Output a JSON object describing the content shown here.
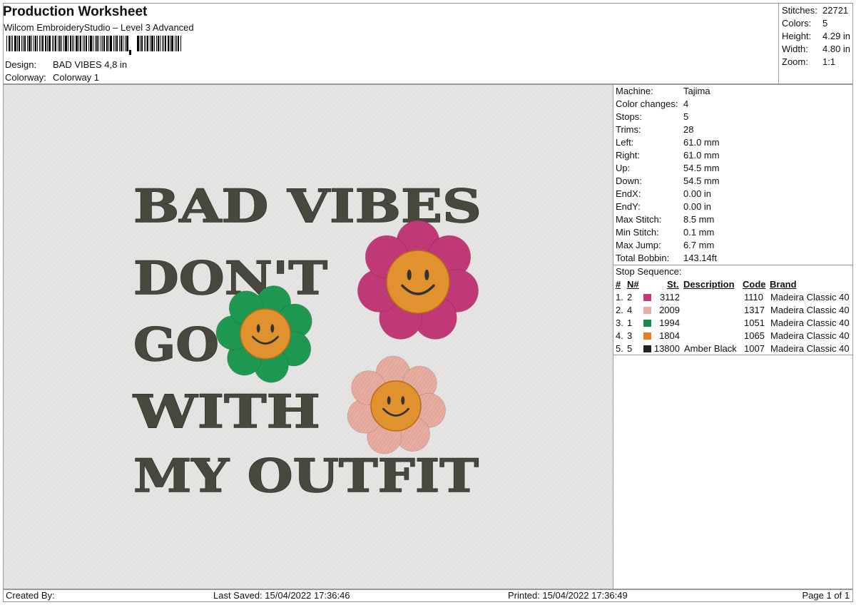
{
  "header": {
    "title": "Production Worksheet",
    "subtitle": "Wilcom EmbroideryStudio – Level 3 Advanced",
    "design_label": "Design:",
    "design_value": "BAD VIBES 4,8 in",
    "colorway_label": "Colorway:",
    "colorway_value": "Colorway 1"
  },
  "summary": [
    {
      "label": "Stitches:",
      "value": "22721"
    },
    {
      "label": "Colors:",
      "value": "5"
    },
    {
      "label": "Height:",
      "value": "4.29 in"
    },
    {
      "label": "Width:",
      "value": "4.80 in"
    },
    {
      "label": "Zoom:",
      "value": "1:1"
    }
  ],
  "machine": [
    {
      "label": "Machine:",
      "value": "Tajima"
    },
    {
      "label": "Color changes:",
      "value": "4"
    },
    {
      "label": "Stops:",
      "value": "5"
    },
    {
      "label": "Trims:",
      "value": "28"
    },
    {
      "label": "Left:",
      "value": "61.0 mm"
    },
    {
      "label": "Right:",
      "value": "61.0 mm"
    },
    {
      "label": "Up:",
      "value": "54.5 mm"
    },
    {
      "label": "Down:",
      "value": "54.5 mm"
    },
    {
      "label": "EndX:",
      "value": "0.00 in"
    },
    {
      "label": "EndY:",
      "value": "0.00 in"
    },
    {
      "label": "Max Stitch:",
      "value": "8.5 mm"
    },
    {
      "label": "Min Stitch:",
      "value": "0.1 mm"
    },
    {
      "label": "Max Jump:",
      "value": "6.7 mm"
    },
    {
      "label": "Total Bobbin:",
      "value": "143.14ft"
    }
  ],
  "stop_sequence": {
    "title": "Stop Sequence:",
    "headers": {
      "num": "#",
      "n": "N#",
      "st": "St.",
      "desc": "Description",
      "code": "Code",
      "brand": "Brand"
    },
    "rows": [
      {
        "num": "1.",
        "n": "2",
        "color": "#c23a78",
        "st": "3112",
        "desc": "",
        "code": "1110",
        "brand": "Madeira Classic 40"
      },
      {
        "num": "2.",
        "n": "4",
        "color": "#e8aca0",
        "st": "2009",
        "desc": "",
        "code": "1317",
        "brand": "Madeira Classic 40"
      },
      {
        "num": "3.",
        "n": "1",
        "color": "#1a8a4a",
        "st": "1994",
        "desc": "",
        "code": "1051",
        "brand": "Madeira Classic 40"
      },
      {
        "num": "4.",
        "n": "3",
        "color": "#e57e1e",
        "st": "1804",
        "desc": "",
        "code": "1065",
        "brand": "Madeira Classic 40"
      },
      {
        "num": "5.",
        "n": "5",
        "color": "#222222",
        "st": "13800",
        "desc": "Amber Black",
        "code": "1007",
        "brand": "Madeira Classic 40"
      }
    ]
  },
  "design": {
    "lines": [
      "BAD VIBES",
      "DON'T",
      "GO",
      "WITH",
      "MY OUTFIT"
    ],
    "colors": {
      "text": "#48483f",
      "pink": "#c23a78",
      "green": "#1f9a52",
      "peach": "#e8aca0",
      "orange": "#e0922e",
      "face": "#333333"
    }
  },
  "footer": {
    "created_by": "Created By:",
    "last_saved": "Last Saved: 15/04/2022 17:36:46",
    "printed": "Printed: 15/04/2022 17:36:49",
    "page": "Page 1 of 1"
  }
}
